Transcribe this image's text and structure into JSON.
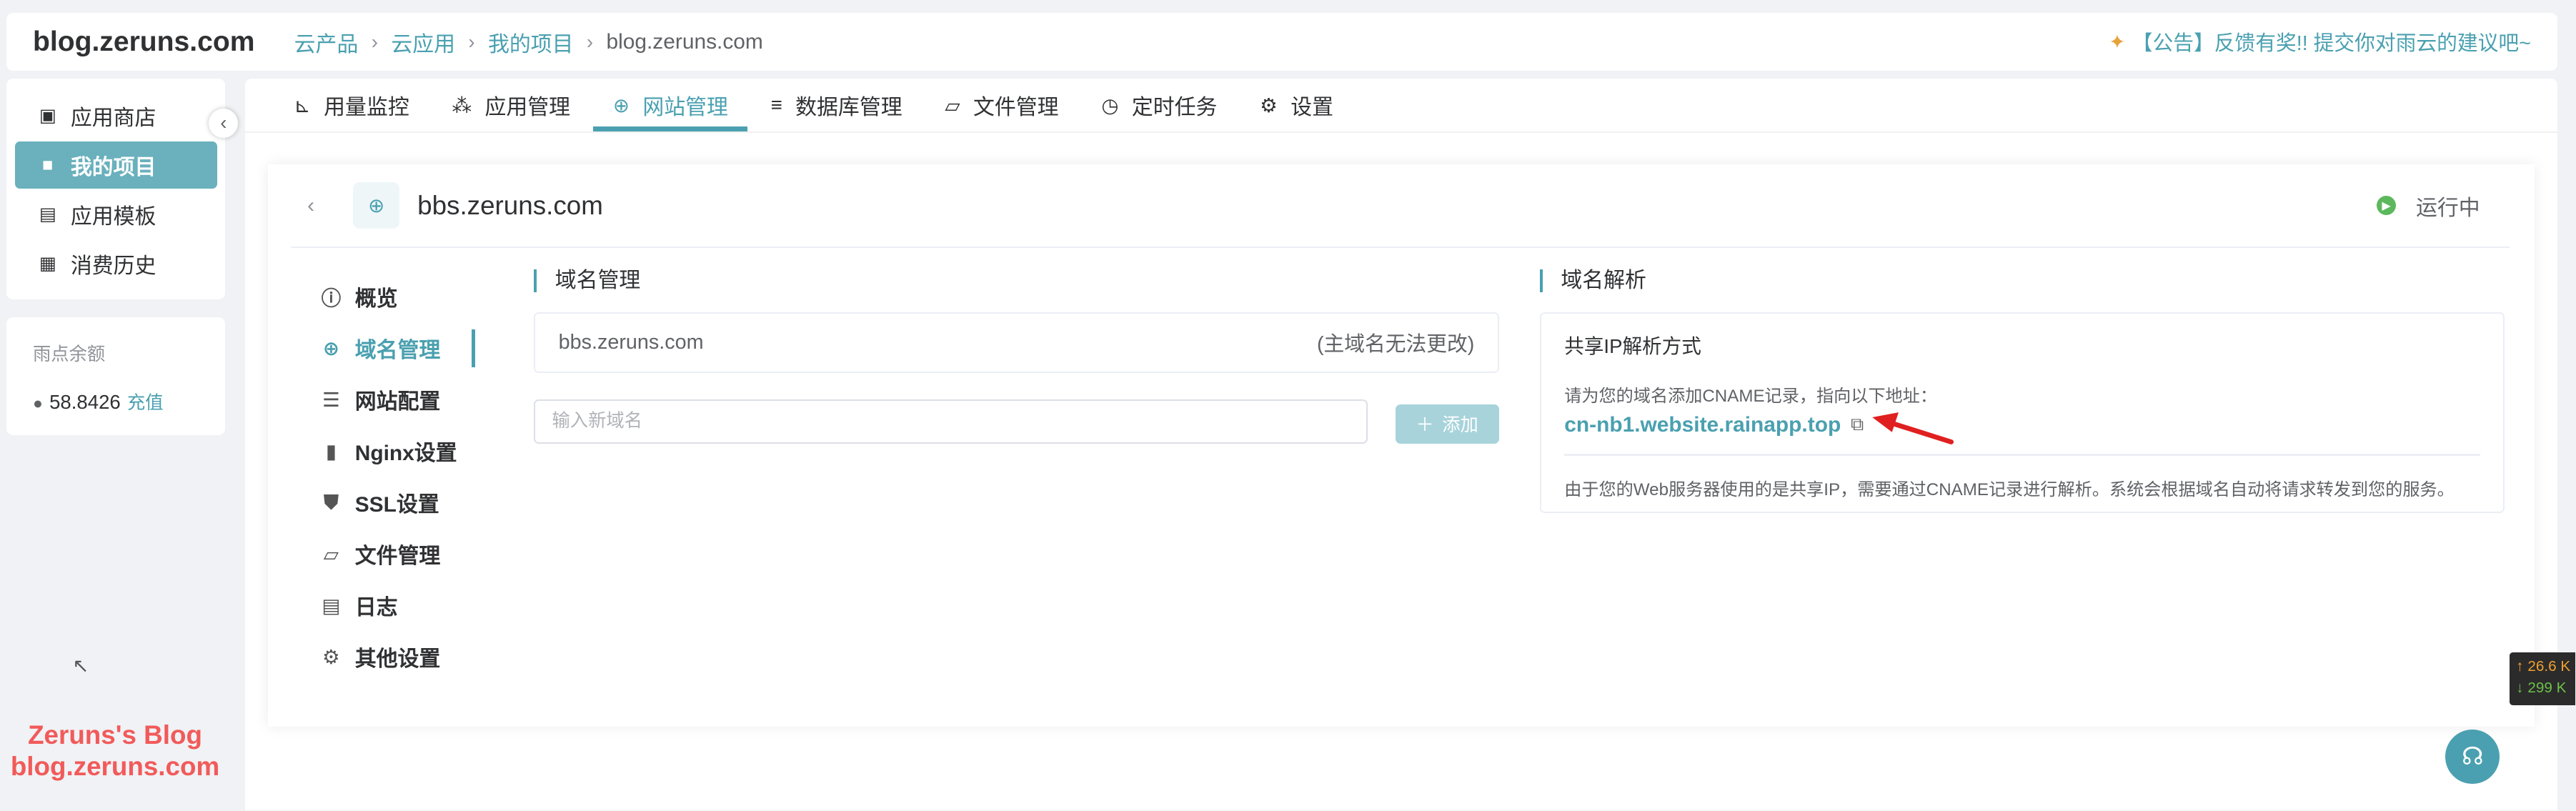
{
  "app": {
    "site": "blog.zeruns.com"
  },
  "breadcrumb": [
    "云产品",
    "云应用",
    "我的项目",
    "blog.zeruns.com"
  ],
  "announcement": "【公告】反馈有奖!! 提交你对雨云的建议吧~",
  "sidebar": {
    "items": [
      {
        "label": "应用商店",
        "icon": "store-icon"
      },
      {
        "label": "我的项目",
        "icon": "folder-icon",
        "active": true
      },
      {
        "label": "应用模板",
        "icon": "template-icon"
      },
      {
        "label": "消费历史",
        "icon": "history-icon"
      }
    ],
    "balance_label": "雨点余额",
    "balance": "58.8426",
    "recharge": "充值"
  },
  "tabs": [
    {
      "label": "用量监控",
      "icon": "chart-icon"
    },
    {
      "label": "应用管理",
      "icon": "apps-icon"
    },
    {
      "label": "网站管理",
      "icon": "globe-icon",
      "active": true
    },
    {
      "label": "数据库管理",
      "icon": "database-icon"
    },
    {
      "label": "文件管理",
      "icon": "folder-open-icon"
    },
    {
      "label": "定时任务",
      "icon": "clock-icon"
    },
    {
      "label": "设置",
      "icon": "gears-icon"
    }
  ],
  "site": {
    "name": "bbs.zeruns.com",
    "status": "运行中"
  },
  "subnav": [
    {
      "label": "概览",
      "icon": "info-icon"
    },
    {
      "label": "域名管理",
      "icon": "globe-icon",
      "active": true
    },
    {
      "label": "网站配置",
      "icon": "sliders-icon"
    },
    {
      "label": "Nginx设置",
      "icon": "file-icon"
    },
    {
      "label": "SSL设置",
      "icon": "shield-icon"
    },
    {
      "label": "文件管理",
      "icon": "folder-open-icon"
    },
    {
      "label": "日志",
      "icon": "clipboard-icon"
    },
    {
      "label": "其他设置",
      "icon": "gear-icon"
    }
  ],
  "domain_mgmt": {
    "title": "域名管理",
    "primary_domain": "bbs.zeruns.com",
    "primary_note": "(主域名无法更改)",
    "new_placeholder": "输入新域名",
    "add_label": "添加"
  },
  "dns": {
    "title": "域名解析",
    "card_title": "共享IP解析方式",
    "desc": "请为您的域名添加CNAME记录，指向以下地址：",
    "cname": "cn-nb1.website.rainapp.top",
    "footer": "由于您的Web服务器使用的是共享IP，需要通过CNAME记录进行解析。系统会根据域名自动将请求转发到您的服务。"
  },
  "watermark": {
    "line1": "Zeruns's Blog",
    "line2": "blog.zeruns.com"
  },
  "speed": {
    "up": "↑ 26.6 K",
    "down": "↓ 299 K"
  },
  "colors": {
    "accent": "#4aa0b0",
    "active_menu": "#6ab0bd",
    "status": "#5cb85c",
    "annotation": "#e02020"
  }
}
